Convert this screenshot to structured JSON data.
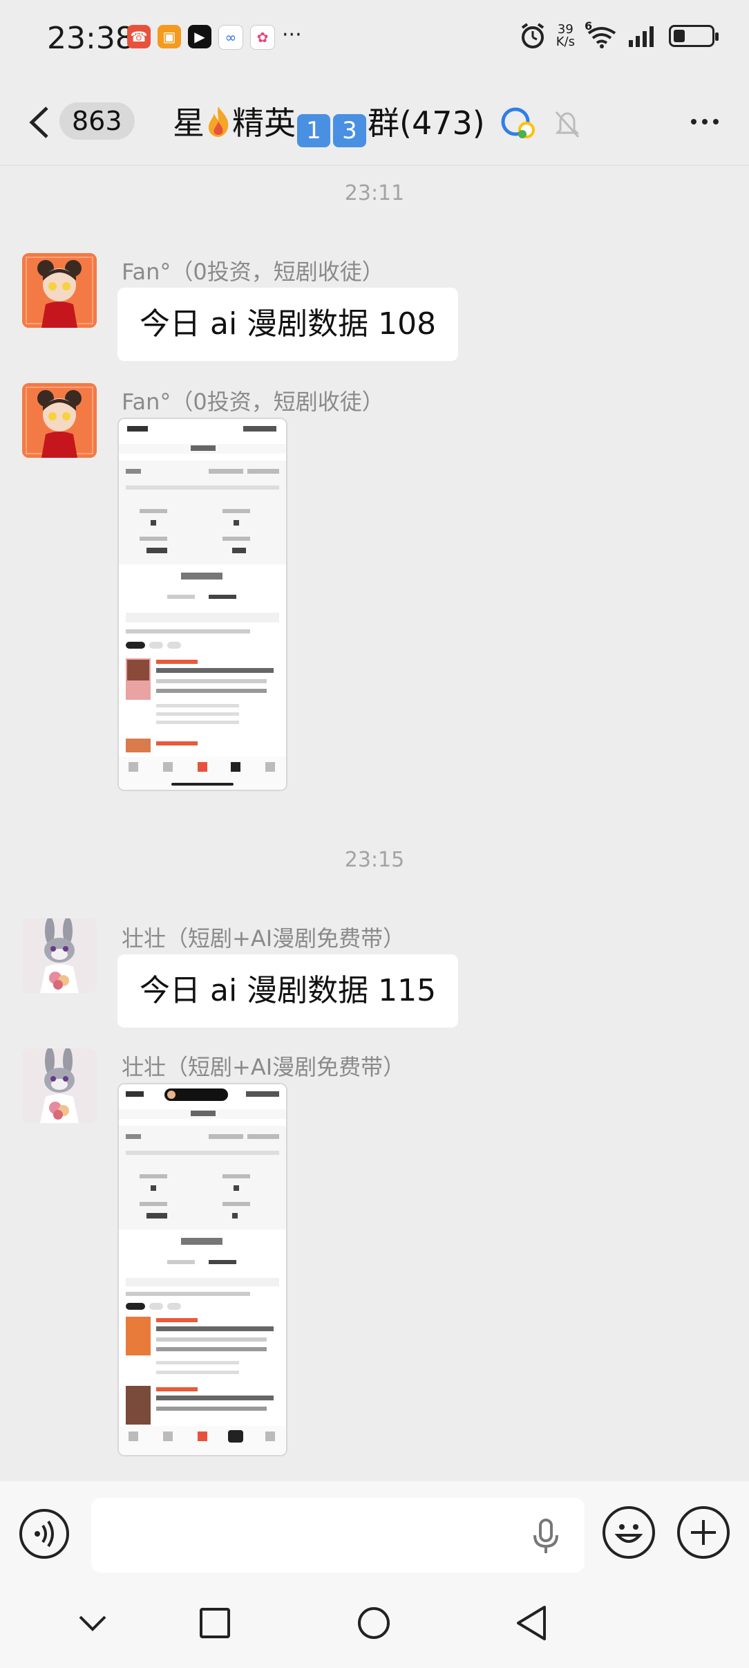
{
  "status_bar": {
    "time": "23:38",
    "net_speed_value": "39",
    "net_speed_unit": "K/s",
    "more_notifications": "···",
    "signal_label": "6"
  },
  "header": {
    "unread_count": "863",
    "title_prefix": "星",
    "title_mid": "精英",
    "emoji_digit_1": "1",
    "emoji_digit_2": "3",
    "title_suffix": "群(473)"
  },
  "messages": [
    {
      "timestamp": "23:11"
    },
    {
      "sender": "Fan°（0投资，短剧收徒）",
      "text": "今日 ai 漫剧数据 108"
    },
    {
      "sender": "Fan°（0投资，短剧收徒）",
      "image": true
    },
    {
      "timestamp": "23:15"
    },
    {
      "sender": "壮壮（短剧+AI漫剧免费带）",
      "text": "今日 ai 漫剧数据 115"
    },
    {
      "sender": "壮壮（短剧+AI漫剧免费带）",
      "image": true
    }
  ],
  "colors": {
    "background": "#ededed",
    "bubble": "#ffffff",
    "meta_text": "#a3a3a3"
  }
}
